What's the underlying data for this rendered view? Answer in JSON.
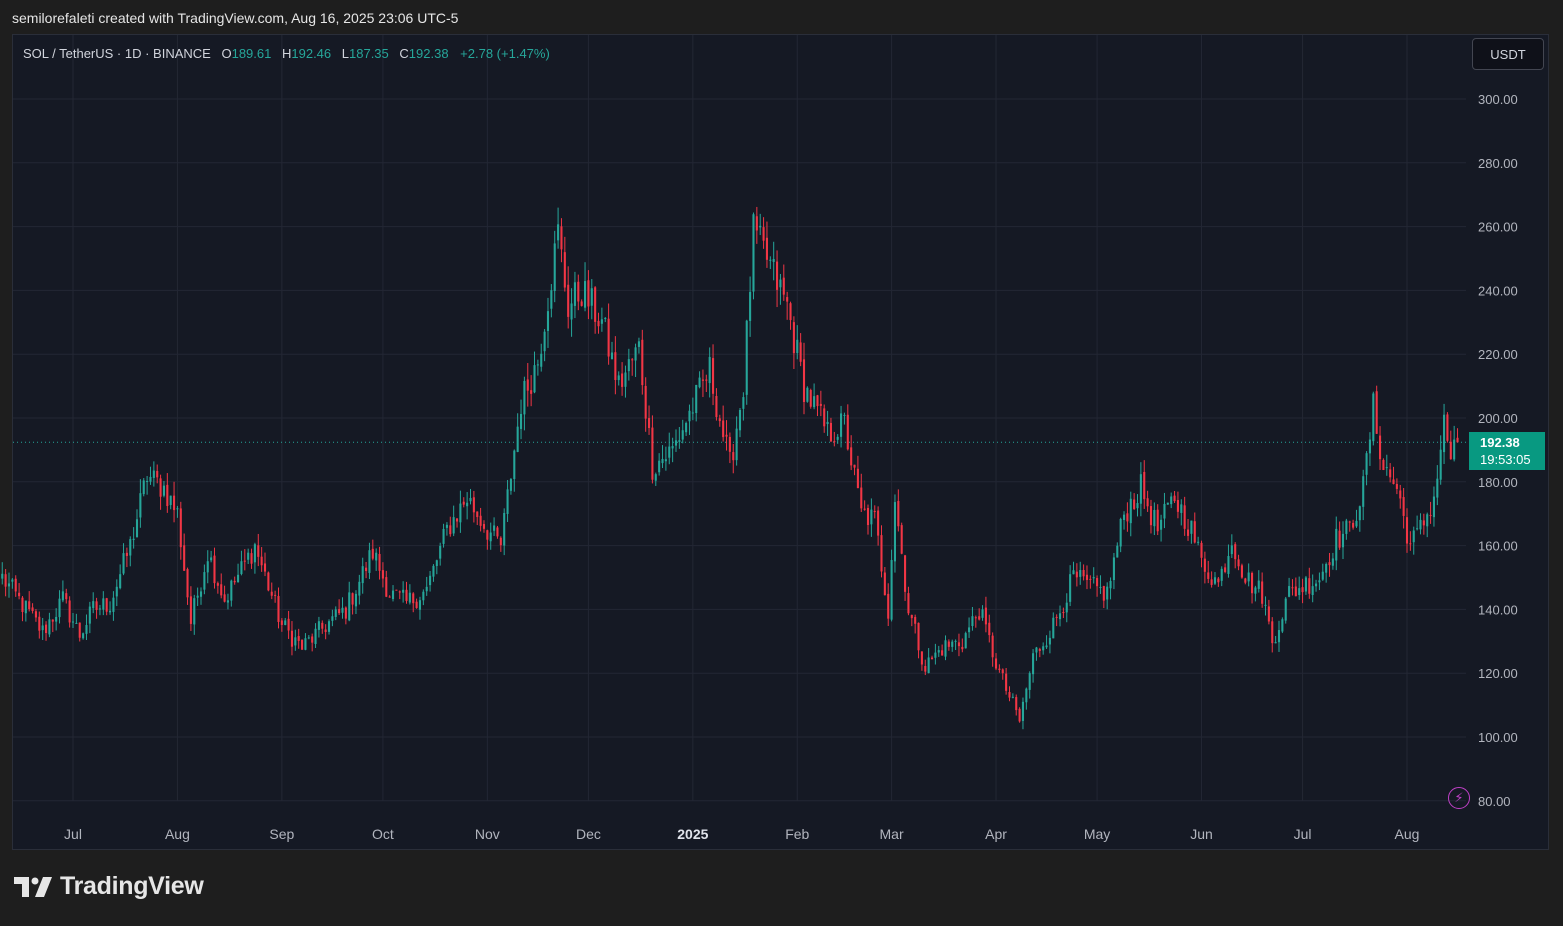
{
  "caption": "semilorefaleti created with TradingView.com, Aug 16, 2025 23:06 UTC-5",
  "legend": {
    "symbol": "SOL / TetherUS · 1D · BINANCE",
    "open_label": "O",
    "open": "189.61",
    "high_label": "H",
    "high": "192.46",
    "low_label": "L",
    "low": "187.35",
    "close_label": "C",
    "close": "192.38",
    "change": "+2.78 (+1.47%)"
  },
  "currency_button": "USDT",
  "last_price_tag": {
    "price": "192.38",
    "countdown": "19:53:05"
  },
  "branding": {
    "logo_text": "TradingView",
    "logo_icon": "tradingview-logo-icon"
  },
  "alert_icon": "lightning-icon",
  "colors": {
    "background": "#151924",
    "up": "#26a69a",
    "down": "#f23645",
    "grid": "#232734",
    "axis_text": "#b2b5be",
    "price_tag": "#089981"
  },
  "chart_data": {
    "type": "candlestick",
    "title": "SOL / TetherUS · 1D · BINANCE",
    "xlabel": "",
    "ylabel": "",
    "ylim": [
      80,
      310
    ],
    "y_ticks": [
      "300.00",
      "280.00",
      "260.00",
      "240.00",
      "220.00",
      "200.00",
      "180.00",
      "160.00",
      "140.00",
      "120.00",
      "100.00",
      "80.00"
    ],
    "x_ticks": [
      {
        "label": "Jul",
        "date": "2024-07-01",
        "bold": false
      },
      {
        "label": "Aug",
        "date": "2024-08-01",
        "bold": false
      },
      {
        "label": "Sep",
        "date": "2024-09-01",
        "bold": false
      },
      {
        "label": "Oct",
        "date": "2024-10-01",
        "bold": false
      },
      {
        "label": "Nov",
        "date": "2024-11-01",
        "bold": false
      },
      {
        "label": "Dec",
        "date": "2024-12-01",
        "bold": false
      },
      {
        "label": "2025",
        "date": "2025-01-01",
        "bold": true
      },
      {
        "label": "Feb",
        "date": "2025-02-01",
        "bold": false
      },
      {
        "label": "Mar",
        "date": "2025-03-01",
        "bold": false
      },
      {
        "label": "Apr",
        "date": "2025-04-01",
        "bold": false
      },
      {
        "label": "May",
        "date": "2025-05-01",
        "bold": false
      },
      {
        "label": "Jun",
        "date": "2025-06-01",
        "bold": false
      },
      {
        "label": "Jul",
        "date": "2025-07-01",
        "bold": false
      },
      {
        "label": "Aug",
        "date": "2025-08-01",
        "bold": false
      }
    ],
    "start_date": "2024-06-10",
    "last_close": 192.38,
    "grid": true,
    "close_path": [
      {
        "date": "2024-06-10",
        "close": 150
      },
      {
        "date": "2024-06-22",
        "close": 133
      },
      {
        "date": "2024-06-28",
        "close": 143
      },
      {
        "date": "2024-07-03",
        "close": 132
      },
      {
        "date": "2024-07-07",
        "close": 140
      },
      {
        "date": "2024-07-12",
        "close": 142
      },
      {
        "date": "2024-07-18",
        "close": 160
      },
      {
        "date": "2024-07-23",
        "close": 182
      },
      {
        "date": "2024-07-28",
        "close": 178
      },
      {
        "date": "2024-08-01",
        "close": 170
      },
      {
        "date": "2024-08-05",
        "close": 136
      },
      {
        "date": "2024-08-10",
        "close": 158
      },
      {
        "date": "2024-08-15",
        "close": 143
      },
      {
        "date": "2024-08-24",
        "close": 160
      },
      {
        "date": "2024-09-01",
        "close": 135
      },
      {
        "date": "2024-09-07",
        "close": 128
      },
      {
        "date": "2024-09-14",
        "close": 135
      },
      {
        "date": "2024-09-20",
        "close": 140
      },
      {
        "date": "2024-09-28",
        "close": 158
      },
      {
        "date": "2024-10-03",
        "close": 145
      },
      {
        "date": "2024-10-08",
        "close": 142
      },
      {
        "date": "2024-10-14",
        "close": 146
      },
      {
        "date": "2024-10-20",
        "close": 165
      },
      {
        "date": "2024-10-26",
        "close": 175
      },
      {
        "date": "2024-11-01",
        "close": 165
      },
      {
        "date": "2024-11-05",
        "close": 160
      },
      {
        "date": "2024-11-11",
        "close": 205
      },
      {
        "date": "2024-11-16",
        "close": 218
      },
      {
        "date": "2024-11-22",
        "close": 258
      },
      {
        "date": "2024-11-25",
        "close": 235
      },
      {
        "date": "2024-11-29",
        "close": 240
      },
      {
        "date": "2024-12-05",
        "close": 230
      },
      {
        "date": "2024-12-10",
        "close": 210
      },
      {
        "date": "2024-12-16",
        "close": 222
      },
      {
        "date": "2024-12-20",
        "close": 185
      },
      {
        "date": "2024-12-26",
        "close": 190
      },
      {
        "date": "2025-01-06",
        "close": 215
      },
      {
        "date": "2025-01-12",
        "close": 185
      },
      {
        "date": "2025-01-16",
        "close": 210
      },
      {
        "date": "2025-01-19",
        "close": 258
      },
      {
        "date": "2025-01-23",
        "close": 250
      },
      {
        "date": "2025-01-29",
        "close": 235
      },
      {
        "date": "2025-02-03",
        "close": 210
      },
      {
        "date": "2025-02-10",
        "close": 195
      },
      {
        "date": "2025-02-15",
        "close": 198
      },
      {
        "date": "2025-02-20",
        "close": 170
      },
      {
        "date": "2025-02-24",
        "close": 168
      },
      {
        "date": "2025-02-28",
        "close": 140
      },
      {
        "date": "2025-03-02",
        "close": 175
      },
      {
        "date": "2025-03-06",
        "close": 140
      },
      {
        "date": "2025-03-11",
        "close": 122
      },
      {
        "date": "2025-03-16",
        "close": 128
      },
      {
        "date": "2025-03-22",
        "close": 130
      },
      {
        "date": "2025-03-27",
        "close": 140
      },
      {
        "date": "2025-04-02",
        "close": 120
      },
      {
        "date": "2025-04-08",
        "close": 105
      },
      {
        "date": "2025-04-12",
        "close": 125
      },
      {
        "date": "2025-04-18",
        "close": 135
      },
      {
        "date": "2025-04-24",
        "close": 150
      },
      {
        "date": "2025-04-29",
        "close": 147
      },
      {
        "date": "2025-05-04",
        "close": 145
      },
      {
        "date": "2025-05-09",
        "close": 170
      },
      {
        "date": "2025-05-14",
        "close": 178
      },
      {
        "date": "2025-05-19",
        "close": 165
      },
      {
        "date": "2025-05-24",
        "close": 175
      },
      {
        "date": "2025-05-29",
        "close": 165
      },
      {
        "date": "2025-06-01",
        "close": 155
      },
      {
        "date": "2025-06-06",
        "close": 148
      },
      {
        "date": "2025-06-10",
        "close": 162
      },
      {
        "date": "2025-06-14",
        "close": 150
      },
      {
        "date": "2025-06-19",
        "close": 145
      },
      {
        "date": "2025-06-22",
        "close": 130
      },
      {
        "date": "2025-06-27",
        "close": 145
      },
      {
        "date": "2025-07-02",
        "close": 148
      },
      {
        "date": "2025-07-06",
        "close": 150
      },
      {
        "date": "2025-07-11",
        "close": 162
      },
      {
        "date": "2025-07-15",
        "close": 165
      },
      {
        "date": "2025-07-19",
        "close": 178
      },
      {
        "date": "2025-07-22",
        "close": 203
      },
      {
        "date": "2025-07-25",
        "close": 185
      },
      {
        "date": "2025-07-29",
        "close": 178
      },
      {
        "date": "2025-08-02",
        "close": 160
      },
      {
        "date": "2025-08-05",
        "close": 165
      },
      {
        "date": "2025-08-09",
        "close": 175
      },
      {
        "date": "2025-08-12",
        "close": 198
      },
      {
        "date": "2025-08-14",
        "close": 188
      },
      {
        "date": "2025-08-16",
        "close": 192.38
      }
    ]
  }
}
